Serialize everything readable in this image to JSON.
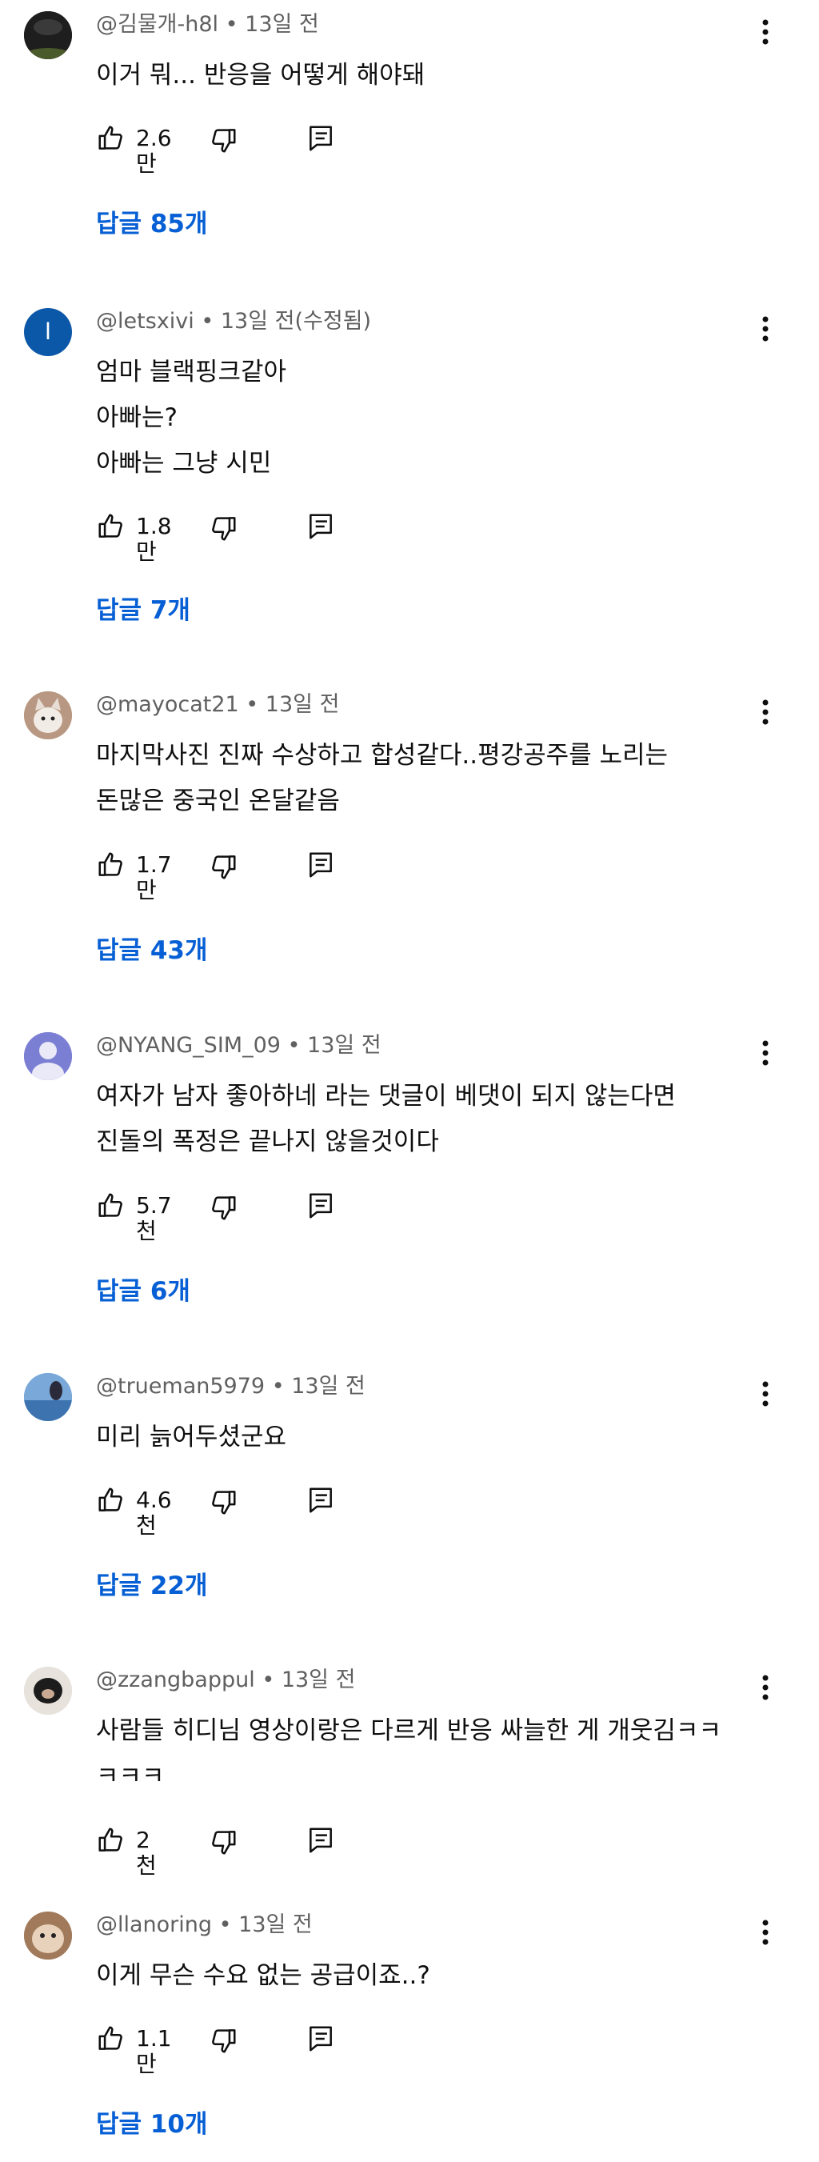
{
  "comments": [
    {
      "author": "@김물개-h8l",
      "time": "• 13일 전",
      "lines": [
        "이거 뭐... 반응을 어떻게 해야돼"
      ],
      "likes": "2.6만",
      "replies": "답글 85개",
      "avatar": {
        "type": "photo",
        "bg": "#2b2b2b",
        "accent": "#4a5a2a"
      }
    },
    {
      "author": "@letsxivi",
      "time": "• 13일 전(수정됨)",
      "lines": [
        "엄마 블랙핑크같아",
        "아빠는?",
        "아빠는 그냥 시민"
      ],
      "likes": "1.8만",
      "replies": "답글 7개",
      "avatar": {
        "type": "letter",
        "letter": "l",
        "bg": "#0b57a8"
      }
    },
    {
      "author": "@mayocat21",
      "time": "• 13일 전",
      "lines": [
        "마지막사진 진짜 수상하고 합성같다..평강공주를 노리는",
        "돈많은 중국인 온달같음"
      ],
      "likes": "1.7만",
      "replies": "답글 43개",
      "avatar": {
        "type": "photo",
        "bg": "#c9a991",
        "accent": "#f2ece6"
      }
    },
    {
      "author": "@NYANG_SIM_09",
      "time": "• 13일 전",
      "lines": [
        "여자가 남자 좋아하네 라는 댓글이 베댓이 되지 않는다면",
        "진돌의 폭정은 끝나지 않을것이다"
      ],
      "likes": "5.7천",
      "replies": "답글 6개",
      "avatar": {
        "type": "default",
        "bg": "#7b7fd4"
      }
    },
    {
      "author": "@trueman5979",
      "time": "• 13일 전",
      "lines": [
        "미리 늙어두셨군요"
      ],
      "likes": "4.6천",
      "replies": "답글 22개",
      "avatar": {
        "type": "photo",
        "bg": "#5a8fc8",
        "accent": "#a9cbe9"
      }
    },
    {
      "author": "@zzangbappul",
      "time": "• 13일 전",
      "lines": [
        "사람들 히디님 영상이랑은 다르게 반응 싸늘한 게 개웃김ㅋㅋ",
        "ㅋㅋㅋ"
      ],
      "likes": "2천",
      "replies": "",
      "avatar": {
        "type": "photo",
        "bg": "#e8e2dd",
        "accent": "#1c1c1c"
      }
    },
    {
      "author": "@llanoring",
      "time": "• 13일 전",
      "lines": [
        "이게 무슨 수요 없는 공급이죠..?"
      ],
      "likes": "1.1만",
      "replies": "답글 10개",
      "avatar": {
        "type": "photo",
        "bg": "#b08a6a",
        "accent": "#e8d2bb"
      }
    }
  ],
  "colors": {
    "reply_link": "#065fd4",
    "meta": "#606060",
    "text": "#0f0f0f"
  },
  "icons": {
    "like": "thumb-up-icon",
    "dislike": "thumb-down-icon",
    "reply": "comment-icon",
    "more": "more-vert-icon"
  }
}
